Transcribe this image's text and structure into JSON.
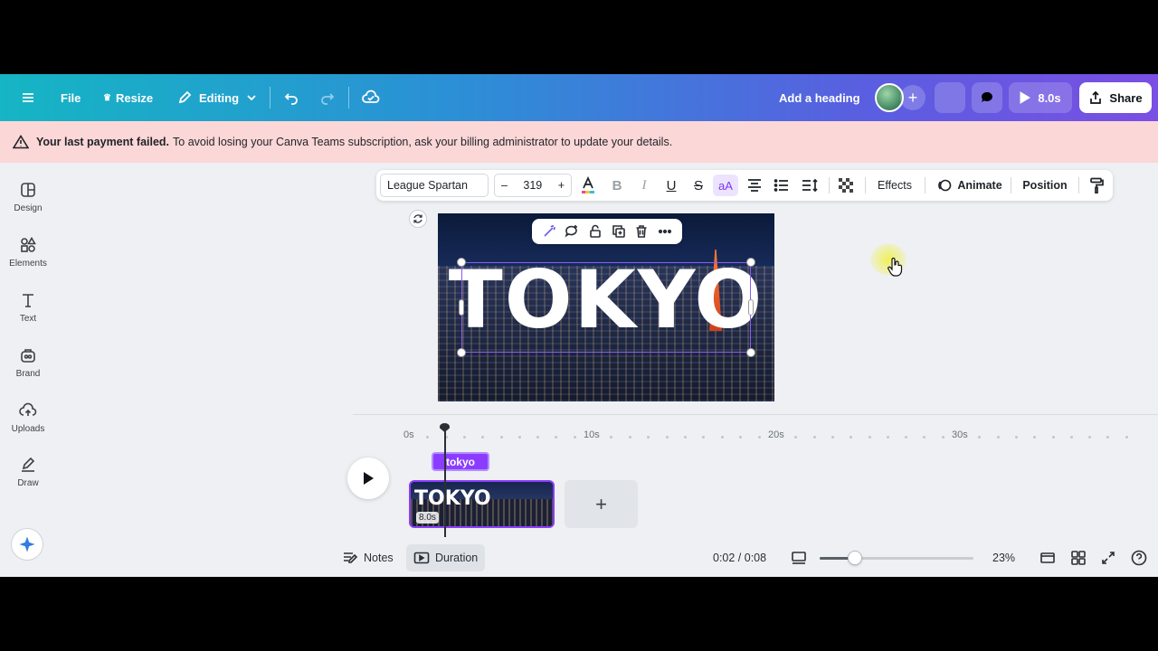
{
  "topbar": {
    "menu_icon": "hamburger-icon",
    "file": "File",
    "resize": "Resize",
    "editing": "Editing",
    "heading": "Add a heading",
    "play_duration": "8.0s",
    "share": "Share"
  },
  "banner": {
    "bold": "Your last payment failed.",
    "text": "To avoid losing your Canva Teams subscription, ask your billing administrator to update your details."
  },
  "sidebar": {
    "items": [
      {
        "label": "Design",
        "icon": "design-icon"
      },
      {
        "label": "Elements",
        "icon": "elements-icon"
      },
      {
        "label": "Text",
        "icon": "text-icon"
      },
      {
        "label": "Brand",
        "icon": "brand-icon"
      },
      {
        "label": "Uploads",
        "icon": "uploads-icon"
      },
      {
        "label": "Draw",
        "icon": "draw-icon"
      }
    ]
  },
  "toolbar": {
    "font": "League Spartan",
    "minus": "–",
    "size": "319",
    "plus": "+",
    "case": "aA",
    "effects": "Effects",
    "animate": "Animate",
    "position": "Position"
  },
  "canvas": {
    "title_text": "TOKYO"
  },
  "timeline": {
    "ticks": [
      "0s",
      "10s",
      "20s",
      "30s"
    ],
    "audio_label": "tokyo",
    "clip_text": "TOKYO",
    "clip_duration": "8.0s",
    "add": "+"
  },
  "bottom": {
    "notes": "Notes",
    "duration": "Duration",
    "time": "0:02 / 0:08",
    "zoom": "23%",
    "zoom_level": 0.23
  },
  "colors": {
    "accent": "#8b3dff",
    "banner_bg": "#fcd7d7"
  }
}
